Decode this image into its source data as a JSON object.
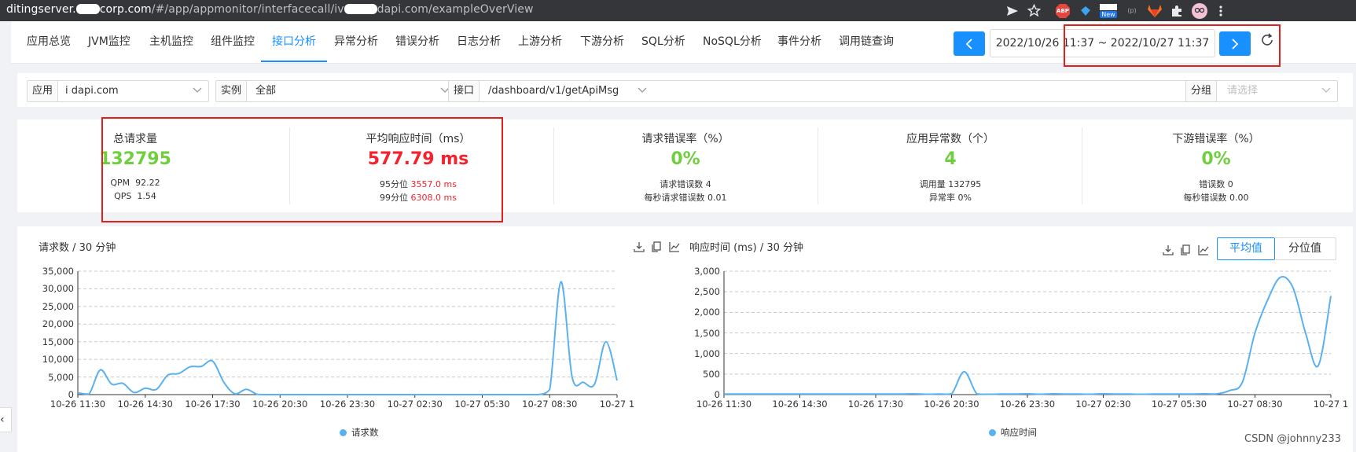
{
  "browser": {
    "url_host_start": "ditingserver.",
    "url_host_mid": "corp.com",
    "url_path_a": "/#/app/appmonitor/interfacecall/iv",
    "url_path_b": "dapi.com/exampleOverView",
    "ext_abp": "ABP",
    "ext_new": "New",
    "ext_p": "(p)"
  },
  "nav": {
    "tabs": [
      "应用总览",
      "JVM监控",
      "主机监控",
      "组件监控",
      "接口分析",
      "异常分析",
      "错误分析",
      "日志分析",
      "上游分析",
      "下游分析",
      "SQL分析",
      "NoSQL分析",
      "事件分析",
      "调用链查询"
    ],
    "active_index": 4,
    "date_range": "2022/10/26 11:37 ~ 2022/10/27 11:37"
  },
  "filters": {
    "app_label": "应用",
    "app_value": "i          dapi.com",
    "instance_label": "实例",
    "instance_value": "全部",
    "api_label": "接口",
    "api_value": "/dashboard/v1/getApiMsg",
    "group_label": "分组",
    "group_placeholder": "请选择"
  },
  "stats": {
    "total": {
      "title": "总请求量",
      "value": "132795",
      "qpm_label": "QPM",
      "qpm": "92.22",
      "qps_label": "QPS",
      "qps": "1.54"
    },
    "latency": {
      "title": "平均响应时间（ms）",
      "value": "577.79 ms",
      "p95_label": "95分位",
      "p95": "3557.0 ms",
      "p99_label": "99分位",
      "p99": "6308.0 ms"
    },
    "error_rate": {
      "title": "请求错误率（%）",
      "value": "0%",
      "l1": "请求错误数",
      "v1": "4",
      "l2": "每秒请求错误数",
      "v2": "0.01"
    },
    "app_exceptions": {
      "title": "应用异常数（个）",
      "value": "4",
      "l1": "调用量",
      "v1": "132795",
      "l2": "异常率",
      "v2": "0%"
    },
    "downstream": {
      "title": "下游错误率（%）",
      "value": "0%",
      "l1": "错误数",
      "v1": "0",
      "l2": "每秒错误数",
      "v2": "0.00"
    }
  },
  "charts": {
    "toggle_avg": "平均值",
    "toggle_pct": "分位值",
    "watermark": "CSDN @johnny233"
  },
  "colors": {
    "accent": "#1890ff",
    "series": "#5ab1ef",
    "green": "#6fcf3f",
    "red": "#f5222d",
    "highlight": "#e0201b"
  },
  "chart_data": [
    {
      "type": "line",
      "title": "请求数 / 30 分钟",
      "ylim": [
        0,
        35000
      ],
      "yticks": [
        "0",
        "5,000",
        "10,000",
        "15,000",
        "20,000",
        "25,000",
        "30,000",
        "35,000"
      ],
      "xticks": [
        "10-26 11:30",
        "10-26 14:30",
        "10-26 17:30",
        "10-26 20:30",
        "10-26 23:30",
        "10-27 02:30",
        "10-27 05:30",
        "10-27 08:30",
        "10-27 1"
      ],
      "series": [
        {
          "name": "请求数",
          "x": [
            0,
            0.5,
            1,
            1.5,
            2,
            2.5,
            3,
            3.5,
            4,
            4.5,
            5,
            5.5,
            6,
            6.5,
            7,
            7.5,
            8,
            8.5,
            9,
            9.5,
            10,
            10.5,
            11,
            11.5,
            12,
            12.5,
            13,
            13.5,
            14,
            14.5,
            15,
            15.5,
            16,
            16.5,
            17,
            17.5,
            18,
            18.5,
            19,
            19.5,
            20,
            20.5,
            21,
            21.5,
            22,
            22.5,
            23,
            23.5,
            24
          ],
          "values": [
            500,
            200,
            7000,
            3000,
            3200,
            600,
            1800,
            1500,
            5500,
            6000,
            7900,
            8000,
            9500,
            3500,
            200,
            1500,
            50,
            0,
            0,
            0,
            0,
            0,
            0,
            0,
            0,
            0,
            0,
            0,
            0,
            0,
            0,
            0,
            0,
            0,
            0,
            0,
            0,
            0,
            0,
            0,
            0,
            0,
            1500,
            32000,
            5000,
            3500,
            3000,
            15000,
            4000
          ]
        }
      ],
      "grid": true,
      "legend": "bottom"
    },
    {
      "type": "line",
      "title": "响应时间 (ms) / 30 分钟",
      "ylim": [
        0,
        3000
      ],
      "yticks": [
        "0",
        "500",
        "1,000",
        "1,500",
        "2,000",
        "2,500",
        "3,000"
      ],
      "xticks": [
        "10-26 11:30",
        "10-26 14:30",
        "10-26 17:30",
        "10-26 20:30",
        "10-26 23:30",
        "10-27 02:30",
        "10-27 05:30",
        "10-27 08:30",
        "10-27 1"
      ],
      "series": [
        {
          "name": "响应时间",
          "x": [
            0,
            0.5,
            1,
            1.5,
            2,
            2.5,
            3,
            3.5,
            4,
            4.5,
            5,
            5.5,
            6,
            6.5,
            7,
            7.5,
            8,
            8.5,
            9,
            9.5,
            10,
            10.5,
            11,
            11.5,
            12,
            12.5,
            13,
            13.5,
            14,
            14.5,
            15,
            15.5,
            16,
            16.5,
            17,
            17.5,
            18,
            18.5,
            19,
            19.5,
            20,
            20.5,
            21,
            21.5,
            22,
            22.5,
            23,
            23.5,
            24
          ],
          "values": [
            15,
            15,
            15,
            15,
            15,
            15,
            15,
            15,
            15,
            15,
            15,
            15,
            15,
            15,
            15,
            20,
            10,
            15,
            20,
            560,
            20,
            10,
            15,
            15,
            20,
            10,
            20,
            15,
            15,
            10,
            20,
            15,
            15,
            10,
            15,
            15,
            15,
            15,
            20,
            20,
            100,
            300,
            1500,
            2300,
            2850,
            2600,
            1500,
            700,
            2400
          ]
        }
      ],
      "grid": true,
      "legend": "bottom"
    }
  ]
}
